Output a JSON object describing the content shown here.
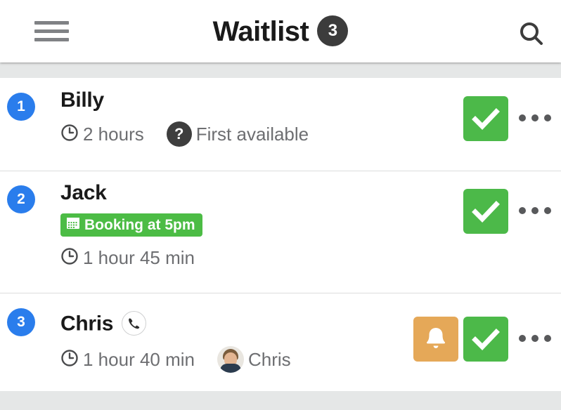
{
  "header": {
    "menu_icon": "hamburger-menu-icon",
    "title": "Waitlist",
    "count_badge": "3",
    "search_icon": "search-icon"
  },
  "list": {
    "rows": [
      {
        "rank": "1",
        "name": "Billy",
        "wait_icon": "clock-icon",
        "wait_time": "2 hours",
        "preference_icon": "question-mark-icon",
        "preference": "First available",
        "actions": {
          "check_label": "check-icon",
          "more_label": "more-options-icon"
        }
      },
      {
        "rank": "2",
        "name": "Jack",
        "booking_icon": "calendar-icon",
        "booking_badge": "Booking at 5pm",
        "wait_icon": "clock-icon",
        "wait_time": "1 hour 45 min",
        "actions": {
          "check_label": "check-icon",
          "more_label": "more-options-icon"
        }
      },
      {
        "rank": "3",
        "name": "Chris",
        "phone_icon": "phone-icon",
        "wait_icon": "clock-icon",
        "wait_time": "1 hour 40 min",
        "assignee_avatar": "avatar-chris",
        "assignee": "Chris",
        "actions": {
          "notify_label": "bell-icon",
          "check_label": "check-icon",
          "more_label": "more-options-icon"
        }
      }
    ]
  },
  "colors": {
    "rank_blue": "#2a7dec",
    "action_green": "#4cb949",
    "action_orange": "#e5a858",
    "badge_green": "#4cbc45",
    "badge_dark": "#3c3c3c",
    "page_background": "#e5e7e7"
  }
}
